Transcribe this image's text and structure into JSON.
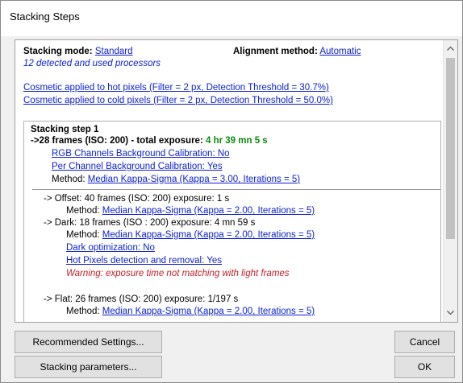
{
  "window": {
    "title": "Stacking Steps"
  },
  "summary": {
    "stacking_mode_label": "Stacking mode:",
    "stacking_mode_value": "Standard",
    "alignment_label": "Alignment method:",
    "alignment_value": "Automatic",
    "processors": "12 detected and used processors",
    "cosmetic_hot": "Cosmetic applied to hot pixels (Filter = 2 px, Detection Threshold = 30.7%)",
    "cosmetic_cold": "Cosmetic applied to cold pixels (Filter = 2 px, Detection Threshold = 50.0%)"
  },
  "step": {
    "title": "Stacking step 1",
    "frames_prefix": "->28 frames (ISO: 200) - total exposure: ",
    "total_exposure": "4 hr 39 mn 5 s",
    "rgb_calibration": "RGB Channels Background Calibration: No",
    "per_channel_calibration": "Per Channel Background Calibration: Yes",
    "method_label": "Method: ",
    "method_value": "Median Kappa-Sigma (Kappa = 3.00, Iterations = 5)",
    "offset_line": "-> Offset: 40 frames (ISO: 200) exposure: 1 s",
    "offset_method_label": "Method: ",
    "offset_method_value": "Median Kappa-Sigma (Kappa = 2.00, Iterations = 5)",
    "dark_line": "-> Dark: 18 frames (ISO : 200) exposure: 4 mn 59 s",
    "dark_method_label": "Method: ",
    "dark_method_value": "Median Kappa-Sigma (Kappa = 2.00, Iterations = 5)",
    "dark_optimization": "Dark optimization: No",
    "hot_pixels": "Hot Pixels detection and removal: Yes",
    "warning": "Warning: exposure time not matching with light frames",
    "flat_line": "-> Flat: 26 frames (ISO: 200) exposure: 1/197 s",
    "flat_method_label": "Method: ",
    "flat_method_value": "Median Kappa-Sigma (Kappa = 2.00, Iterations = 5)"
  },
  "buttons": {
    "recommended": "Recommended Settings...",
    "stacking_params": "Stacking parameters...",
    "cancel": "Cancel",
    "ok": "OK"
  },
  "icons": {
    "scroll_up": "chevron-up-icon",
    "scroll_down": "chevron-down-icon"
  },
  "colors": {
    "link": "#0b1ecc",
    "exposure_green": "#0a8a0a",
    "warning_red": "#c0202a"
  }
}
